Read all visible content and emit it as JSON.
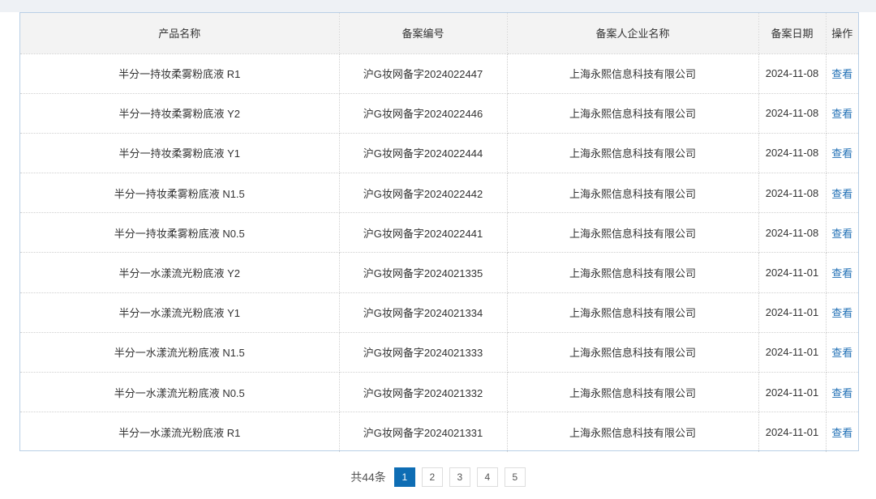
{
  "table": {
    "headers": [
      "产品名称",
      "备案编号",
      "备案人企业名称",
      "备案日期",
      "操作"
    ],
    "rows": [
      {
        "name": "半分一持妆柔雾粉底液 R1",
        "code": "沪G妆网备字2024022447",
        "company": "上海永熙信息科技有限公司",
        "date": "2024-11-08",
        "action": "查看"
      },
      {
        "name": "半分一持妆柔雾粉底液 Y2",
        "code": "沪G妆网备字2024022446",
        "company": "上海永熙信息科技有限公司",
        "date": "2024-11-08",
        "action": "查看"
      },
      {
        "name": "半分一持妆柔雾粉底液 Y1",
        "code": "沪G妆网备字2024022444",
        "company": "上海永熙信息科技有限公司",
        "date": "2024-11-08",
        "action": "查看"
      },
      {
        "name": "半分一持妆柔雾粉底液 N1.5",
        "code": "沪G妆网备字2024022442",
        "company": "上海永熙信息科技有限公司",
        "date": "2024-11-08",
        "action": "查看"
      },
      {
        "name": "半分一持妆柔雾粉底液 N0.5",
        "code": "沪G妆网备字2024022441",
        "company": "上海永熙信息科技有限公司",
        "date": "2024-11-08",
        "action": "查看"
      },
      {
        "name": "半分一水漾流光粉底液 Y2",
        "code": "沪G妆网备字2024021335",
        "company": "上海永熙信息科技有限公司",
        "date": "2024-11-01",
        "action": "查看"
      },
      {
        "name": "半分一水漾流光粉底液 Y1",
        "code": "沪G妆网备字2024021334",
        "company": "上海永熙信息科技有限公司",
        "date": "2024-11-01",
        "action": "查看"
      },
      {
        "name": "半分一水漾流光粉底液 N1.5",
        "code": "沪G妆网备字2024021333",
        "company": "上海永熙信息科技有限公司",
        "date": "2024-11-01",
        "action": "查看"
      },
      {
        "name": "半分一水漾流光粉底液 N0.5",
        "code": "沪G妆网备字2024021332",
        "company": "上海永熙信息科技有限公司",
        "date": "2024-11-01",
        "action": "查看"
      },
      {
        "name": "半分一水漾流光粉底液 R1",
        "code": "沪G妆网备字2024021331",
        "company": "上海永熙信息科技有限公司",
        "date": "2024-11-01",
        "action": "查看"
      }
    ]
  },
  "pagination": {
    "total_label": "共44条",
    "pages": [
      "1",
      "2",
      "3",
      "4",
      "5"
    ],
    "current": "1"
  },
  "colors": {
    "accent": "#0e6db4",
    "link": "#1f6fb5",
    "header_bg": "#f3f3f3",
    "table_border": "#b9cfe6"
  }
}
